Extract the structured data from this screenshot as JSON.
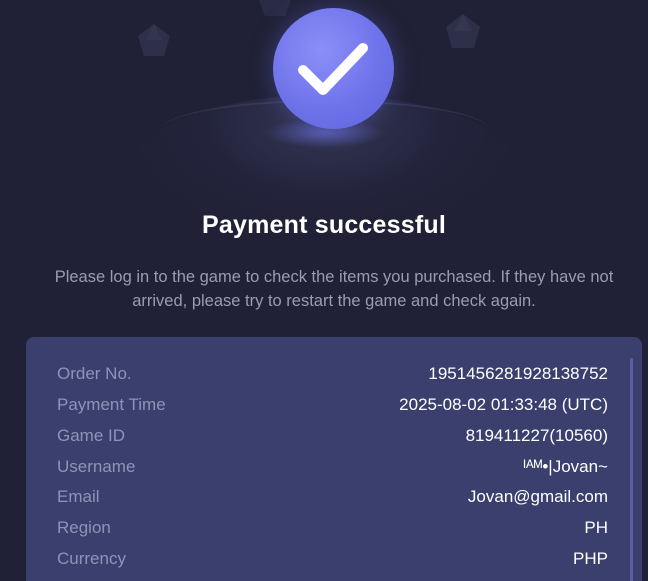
{
  "header": {
    "icon": "check-icon",
    "title": "Payment successful",
    "message": "Please log in to the game to check the items you purchased. If they have not arrived, please try to restart the game and check again."
  },
  "details": [
    {
      "label": "Order No.",
      "value": "1951456281928138752"
    },
    {
      "label": "Payment Time",
      "value": "2025-08-02 01:33:48 (UTC)"
    },
    {
      "label": "Game ID",
      "value": "819411227(10560)"
    },
    {
      "label": "Username",
      "value": "ᴵᴬᴹ•|Jovan~"
    },
    {
      "label": "Email",
      "value": "Jovan@gmail.com"
    },
    {
      "label": "Region",
      "value": "PH"
    },
    {
      "label": "Currency",
      "value": "PHP"
    }
  ],
  "colors": {
    "background": "#202136",
    "accent": "#6f73ea",
    "card": "#3b3f6e"
  }
}
